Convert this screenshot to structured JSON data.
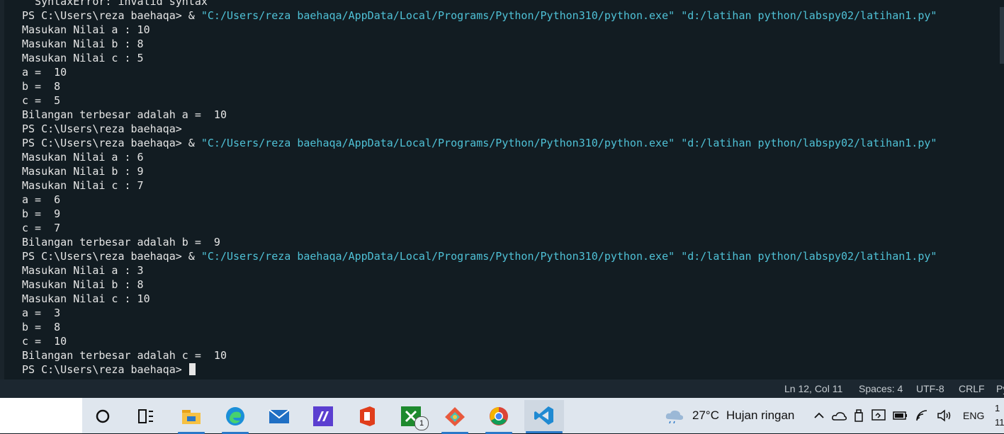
{
  "terminal": {
    "lines": [
      [
        {
          "t": "  SyntaxError: invalid syntax"
        }
      ],
      [
        {
          "t": "PS C:\\Users\\reza baehaqa> & "
        },
        {
          "t": "\"C:/Users/reza baehaqa/AppData/Local/Programs/Python/Python310/python.exe\"",
          "s": 1
        },
        {
          "t": " "
        },
        {
          "t": "\"d:/latihan python/labspy02/latihan1.py\"",
          "s": 1
        }
      ],
      [
        {
          "t": "Masukan Nilai a : 10"
        }
      ],
      [
        {
          "t": "Masukan Nilai b : 8"
        }
      ],
      [
        {
          "t": "Masukan Nilai c : 5"
        }
      ],
      [
        {
          "t": "a =  10"
        }
      ],
      [
        {
          "t": "b =  8"
        }
      ],
      [
        {
          "t": "c =  5"
        }
      ],
      [
        {
          "t": "Bilangan terbesar adalah a =  10"
        }
      ],
      [
        {
          "t": "PS C:\\Users\\reza baehaqa>"
        }
      ],
      [
        {
          "t": "PS C:\\Users\\reza baehaqa> & "
        },
        {
          "t": "\"C:/Users/reza baehaqa/AppData/Local/Programs/Python/Python310/python.exe\"",
          "s": 1
        },
        {
          "t": " "
        },
        {
          "t": "\"d:/latihan python/labspy02/latihan1.py\"",
          "s": 1
        }
      ],
      [
        {
          "t": "Masukan Nilai a : 6"
        }
      ],
      [
        {
          "t": "Masukan Nilai b : 9"
        }
      ],
      [
        {
          "t": "Masukan Nilai c : 7"
        }
      ],
      [
        {
          "t": "a =  6"
        }
      ],
      [
        {
          "t": "b =  9"
        }
      ],
      [
        {
          "t": "c =  7"
        }
      ],
      [
        {
          "t": "Bilangan terbesar adalah b =  9"
        }
      ],
      [
        {
          "t": "PS C:\\Users\\reza baehaqa> & "
        },
        {
          "t": "\"C:/Users/reza baehaqa/AppData/Local/Programs/Python/Python310/python.exe\"",
          "s": 1
        },
        {
          "t": " "
        },
        {
          "t": "\"d:/latihan python/labspy02/latihan1.py\"",
          "s": 1
        }
      ],
      [
        {
          "t": "Masukan Nilai a : 3"
        }
      ],
      [
        {
          "t": "Masukan Nilai b : 8"
        }
      ],
      [
        {
          "t": "Masukan Nilai c : 10"
        }
      ],
      [
        {
          "t": "a =  3"
        }
      ],
      [
        {
          "t": "b =  8"
        }
      ],
      [
        {
          "t": "c =  10"
        }
      ],
      [
        {
          "t": "Bilangan terbesar adalah c =  10"
        }
      ],
      [
        {
          "t": "PS C:\\Users\\reza baehaqa> "
        }
      ]
    ],
    "colors": {
      "text": "#e6e6e6",
      "string": "#4fc1d6",
      "background": "#121c22"
    }
  },
  "statusbar": {
    "position": "Ln 12, Col 11",
    "spaces": "Spaces: 4",
    "encoding": "UTF-8",
    "eol": "CRLF",
    "language": "Py"
  },
  "taskbar": {
    "apps": [
      {
        "name": "cortana-icon"
      },
      {
        "name": "task-view-icon"
      },
      {
        "name": "file-explorer-icon",
        "running": true
      },
      {
        "name": "edge-icon",
        "running": true
      },
      {
        "name": "mail-icon"
      },
      {
        "name": "visual-studio-icon"
      },
      {
        "name": "office-icon"
      },
      {
        "name": "xbox-icon",
        "badge": "1"
      },
      {
        "name": "git-icon",
        "running": true
      },
      {
        "name": "chrome-icon",
        "running": true
      },
      {
        "name": "vscode-icon",
        "running": true,
        "active": true
      }
    ],
    "weather": {
      "temp": "27°C",
      "desc": "Hujan ringan"
    },
    "language": "ENG",
    "clock": {
      "line1": "1",
      "line2": "11"
    }
  }
}
